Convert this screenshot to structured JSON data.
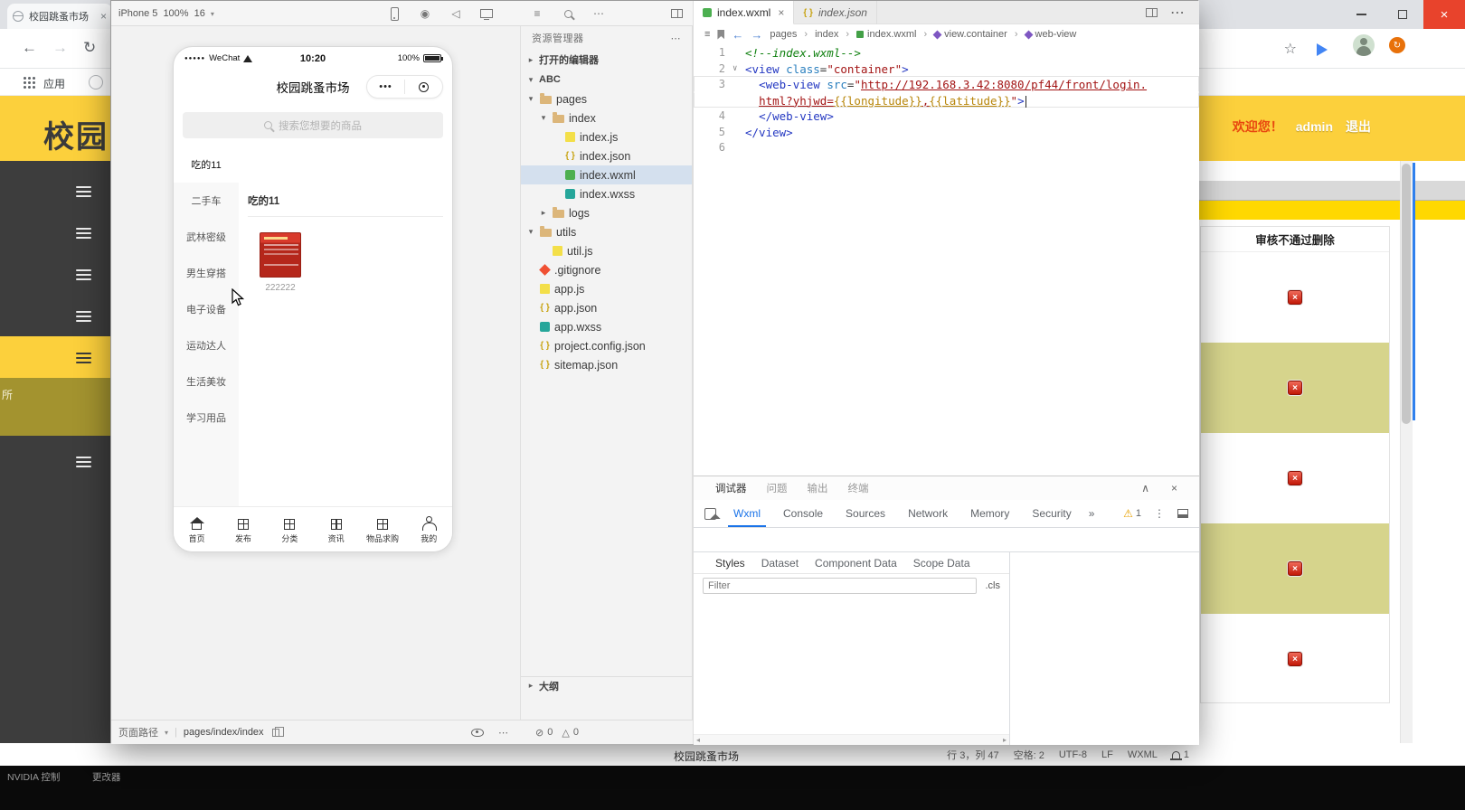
{
  "icons": {
    "close": "×",
    "more_h": "⋯",
    "more_v": "⋮",
    "chevron_open": "▾",
    "chevron_closed": "▸",
    "fold": "∨",
    "collapse": "∧",
    "back": "←",
    "forward": "→",
    "reload": "↻",
    "star": "☆",
    "overflow": "»",
    "sep": "›",
    "record": "◉",
    "speaker": "◁",
    "list": "≡",
    "error_circle": "⊘",
    "warn_tri": "△",
    "warning": "⚠",
    "dots3": "•••",
    "dropdown": "▾",
    "min": "—"
  },
  "browser": {
    "tab_title": "校园跳蚤市场",
    "bookmarks": {
      "apps": "应用"
    },
    "header": {
      "title": "校园",
      "welcome": "欢迎您！",
      "user": "admin",
      "logout": "退出"
    },
    "sidebar": {
      "items": [
        {
          "tone": "dark"
        },
        {
          "tone": "dark"
        },
        {
          "tone": "dark"
        },
        {
          "tone": "dark"
        },
        {
          "tone": "yellow"
        },
        {
          "tone": "olive",
          "partial": "所"
        },
        {
          "tone": "dark"
        }
      ]
    },
    "audit": {
      "header": "审核不通过删除",
      "delete_glyph": "×",
      "rows": [
        {
          "tone": "light"
        },
        {
          "tone": "khaki"
        },
        {
          "tone": "light"
        },
        {
          "tone": "khaki"
        },
        {
          "tone": "light"
        }
      ]
    },
    "footer_title": "校园跳蚤市场",
    "taskbar": {
      "t1": "NVIDIA 控制",
      "t2": "更改器"
    }
  },
  "devtools": {
    "toolbar": {
      "device": "iPhone 5",
      "zoom": "100%",
      "net": "16"
    },
    "simulator": {
      "status": {
        "dots": "●●●●●",
        "carrier": "WeChat",
        "time": "10:20",
        "battery": "100%"
      },
      "nav_title": "校园跳蚤市场",
      "capsule_dots": "•••",
      "search_placeholder": "搜索您想要的商品",
      "categories": [
        {
          "label": "吃的11",
          "active": true
        },
        {
          "label": "二手车"
        },
        {
          "label": "武林密级"
        },
        {
          "label": "男生穿搭"
        },
        {
          "label": "电子设备"
        },
        {
          "label": "运动达人"
        },
        {
          "label": "生活美妆"
        },
        {
          "label": "学习用品"
        }
      ],
      "section_title": "吃的11",
      "product_caption": "222222",
      "tabbar": [
        {
          "label": "首页",
          "icon": "home"
        },
        {
          "label": "发布",
          "icon": "grid"
        },
        {
          "label": "分类",
          "icon": "grid"
        },
        {
          "label": "资讯",
          "icon": "grid"
        },
        {
          "label": "物品求购",
          "icon": "grid"
        },
        {
          "label": "我的",
          "icon": "user"
        }
      ]
    },
    "bottombar": {
      "path_label": "页面路径",
      "path_value": "pages/index/index",
      "errors": "0",
      "warnings": "0"
    },
    "explorer": {
      "title": "资源管理器",
      "open_editors": "打开的编辑器",
      "project": "ABC",
      "outline": "大纲",
      "tree": [
        {
          "name": "pages",
          "depth": 1,
          "icon": "folder",
          "expand": "open"
        },
        {
          "name": "index",
          "depth": 2,
          "icon": "folder",
          "expand": "open"
        },
        {
          "name": "index.js",
          "depth": 3,
          "icon": "js"
        },
        {
          "name": "index.json",
          "depth": 3,
          "icon": "json"
        },
        {
          "name": "index.wxml",
          "depth": 3,
          "icon": "wxml",
          "selected": true
        },
        {
          "name": "index.wxss",
          "depth": 3,
          "icon": "wxss"
        },
        {
          "name": "logs",
          "depth": 2,
          "icon": "folder",
          "expand": "closed"
        },
        {
          "name": "utils",
          "depth": 1,
          "icon": "folder",
          "expand": "open"
        },
        {
          "name": "util.js",
          "depth": 2,
          "icon": "js"
        },
        {
          "name": ".gitignore",
          "depth": 1,
          "icon": "git"
        },
        {
          "name": "app.js",
          "depth": 1,
          "icon": "js"
        },
        {
          "name": "app.json",
          "depth": 1,
          "icon": "json"
        },
        {
          "name": "app.wxss",
          "depth": 1,
          "icon": "wxss"
        },
        {
          "name": "project.config.json",
          "depth": 1,
          "icon": "json"
        },
        {
          "name": "sitemap.json",
          "depth": 1,
          "icon": "json"
        }
      ]
    },
    "editor": {
      "tabs": [
        {
          "label": "index.wxml",
          "icon": "wxml",
          "active": true,
          "close": "×"
        },
        {
          "label": "index.json",
          "icon": "json",
          "preview": true
        }
      ],
      "breadcrumb": [
        {
          "label": "pages"
        },
        {
          "label": "index"
        },
        {
          "label": "index.wxml",
          "icon": "wxml"
        },
        {
          "label": "view.container",
          "icon": "node"
        },
        {
          "label": "web-view",
          "icon": "node"
        }
      ],
      "code": {
        "rows": [
          {
            "num": "1",
            "tokens": [
              {
                "t": "<!--index.wxml-->",
                "c": "comment"
              }
            ]
          },
          {
            "num": "2",
            "fold": true,
            "tokens": [
              {
                "t": "<view ",
                "c": "tag"
              },
              {
                "t": "class",
                "c": "attr"
              },
              {
                "t": "=",
                "c": "plain"
              },
              {
                "t": "\"container\"",
                "c": "string"
              },
              {
                "t": ">",
                "c": "tag"
              }
            ]
          },
          {
            "num": "3",
            "cur": "top",
            "tokens": [
              {
                "t": "  ",
                "c": "plain"
              },
              {
                "t": "<web-view ",
                "c": "tag"
              },
              {
                "t": "src",
                "c": "attr"
              },
              {
                "t": "=",
                "c": "plain"
              },
              {
                "t": "\"",
                "c": "string"
              },
              {
                "t": "http://192.168.3.42:8080/pf44/front/login.",
                "c": "string url"
              }
            ]
          },
          {
            "num": "",
            "cur": "bottom",
            "caret": true,
            "tokens": [
              {
                "t": "  ",
                "c": "plain"
              },
              {
                "t": "html?yhjwd=",
                "c": "string url"
              },
              {
                "t": "{{longitude}}",
                "c": "mustache url"
              },
              {
                "t": ",",
                "c": "string url"
              },
              {
                "t": "{{latitude}}",
                "c": "mustache url"
              },
              {
                "t": "\"",
                "c": "string"
              },
              {
                "t": ">",
                "c": "tag"
              }
            ]
          },
          {
            "num": "4",
            "tokens": [
              {
                "t": "  ",
                "c": "plain"
              },
              {
                "t": "</web-view>",
                "c": "tag"
              }
            ]
          },
          {
            "num": "5",
            "tokens": [
              {
                "t": "</view>",
                "c": "tag"
              }
            ]
          },
          {
            "num": "6",
            "tokens": []
          }
        ]
      },
      "status": {
        "items": [
          "行 3，列 47",
          "空格: 2",
          "UTF-8",
          "LF",
          "WXML"
        ],
        "bell_count": "1"
      }
    },
    "debugger": {
      "panel_tabs": [
        {
          "label": "调试器",
          "active": true
        },
        {
          "label": "问题"
        },
        {
          "label": "输出"
        },
        {
          "label": "终端"
        }
      ],
      "cdt_tabs": [
        {
          "label": "Wxml",
          "active": true
        },
        {
          "label": "Console"
        },
        {
          "label": "Sources"
        },
        {
          "label": "Network"
        },
        {
          "label": "Memory"
        },
        {
          "label": "Security"
        }
      ],
      "warn_count": "1",
      "styles_tabs": [
        {
          "label": "Styles",
          "active": true
        },
        {
          "label": "Dataset"
        },
        {
          "label": "Component Data"
        },
        {
          "label": "Scope Data"
        }
      ],
      "filter_placeholder": "Filter",
      "cls_label": ".cls"
    }
  }
}
